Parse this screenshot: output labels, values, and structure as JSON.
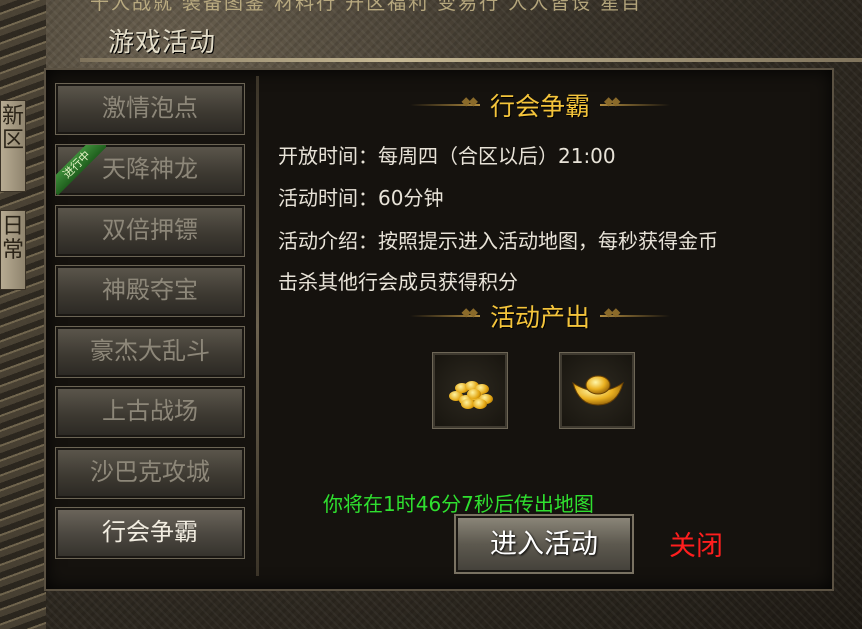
{
  "window": {
    "title": "游戏活动",
    "top_strip_text": "千人战就 装备图鉴 材料行 开区福利 变易行 人人皆设 星目"
  },
  "side_tabs": [
    {
      "label": "新区"
    },
    {
      "label": "日常"
    }
  ],
  "menu": {
    "items": [
      {
        "label": "激情泡点"
      },
      {
        "label": "天降神龙",
        "badge": "进行中"
      },
      {
        "label": "双倍押镖"
      },
      {
        "label": "神殿夺宝"
      },
      {
        "label": "豪杰大乱斗"
      },
      {
        "label": "上古战场"
      },
      {
        "label": "沙巴克攻城"
      },
      {
        "label": "行会争霸"
      }
    ],
    "active": "行会争霸"
  },
  "detail": {
    "heading": "行会争霸",
    "open_time": "开放时间：每周四（合区以后）21:00",
    "duration": "活动时间：60分钟",
    "intro_line1": "活动介绍：按照提示进入活动地图，每秒获得金币",
    "intro_line2": "击杀其他行会成员获得积分",
    "rewards_heading": "活动产出",
    "rewards": [
      {
        "icon": "gold-coins-icon"
      },
      {
        "icon": "gold-ingot-icon"
      }
    ],
    "countdown": "你将在1时46分7秒后传出地图"
  },
  "actions": {
    "enter_label": "进入活动",
    "close_label": "关闭"
  },
  "colors": {
    "heading": "#f4c43b",
    "countdown": "#2fe02f",
    "close": "#ff1e1e"
  }
}
